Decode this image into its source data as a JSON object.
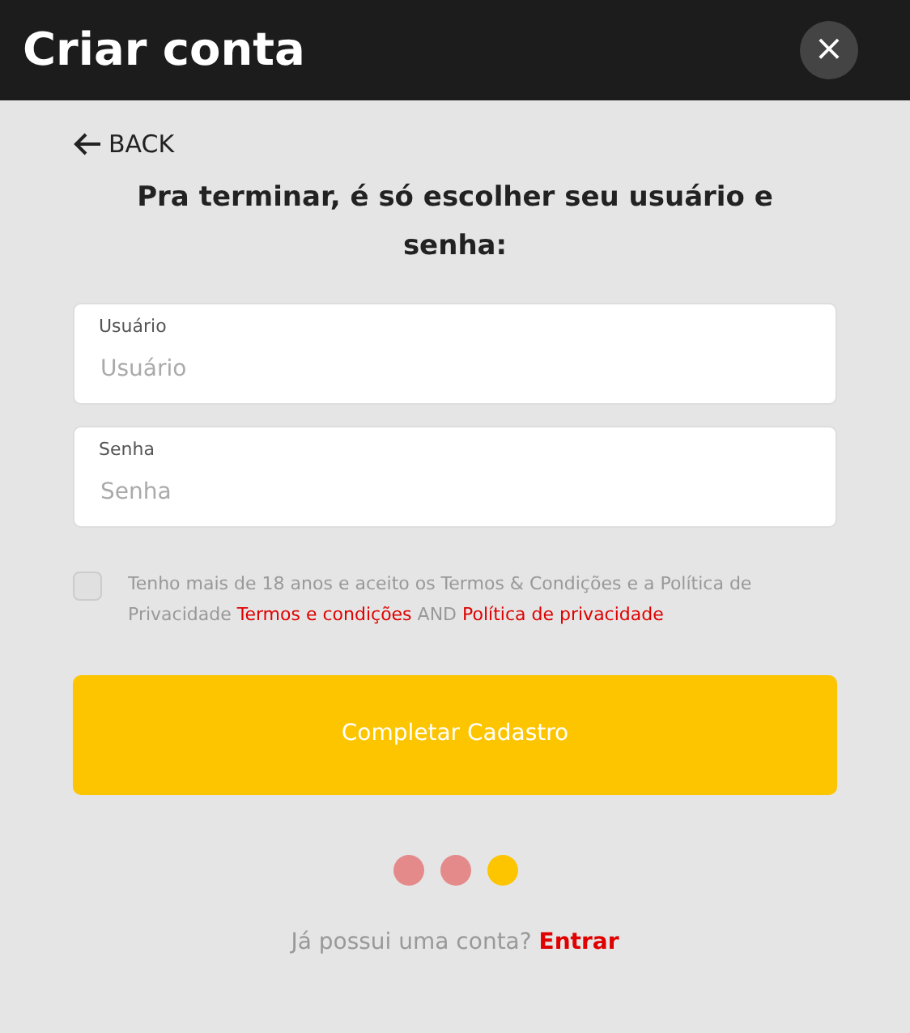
{
  "header": {
    "title": "Criar conta",
    "close": "×"
  },
  "back": {
    "label": "BACK"
  },
  "heading": "Pra terminar, é só escolher seu usuário e senha:",
  "fields": [
    {
      "label": "Usuário",
      "placeholder": "Usuário"
    },
    {
      "label": "Senha",
      "placeholder": "Senha"
    }
  ],
  "consent": {
    "checked": false,
    "text": "Tenho mais de 18 anos e aceito os Termos & Condições e a Política de Privacidade",
    "terms_link": "Termos e condições",
    "joiner": "AND",
    "privacy_link": "Política de privacidade"
  },
  "submit": "Completar Cadastro",
  "steps": [
    {
      "selected": false
    },
    {
      "selected": false
    },
    {
      "selected": true
    }
  ],
  "footer": {
    "text": "Já possui uma conta?",
    "link": "Entrar"
  }
}
